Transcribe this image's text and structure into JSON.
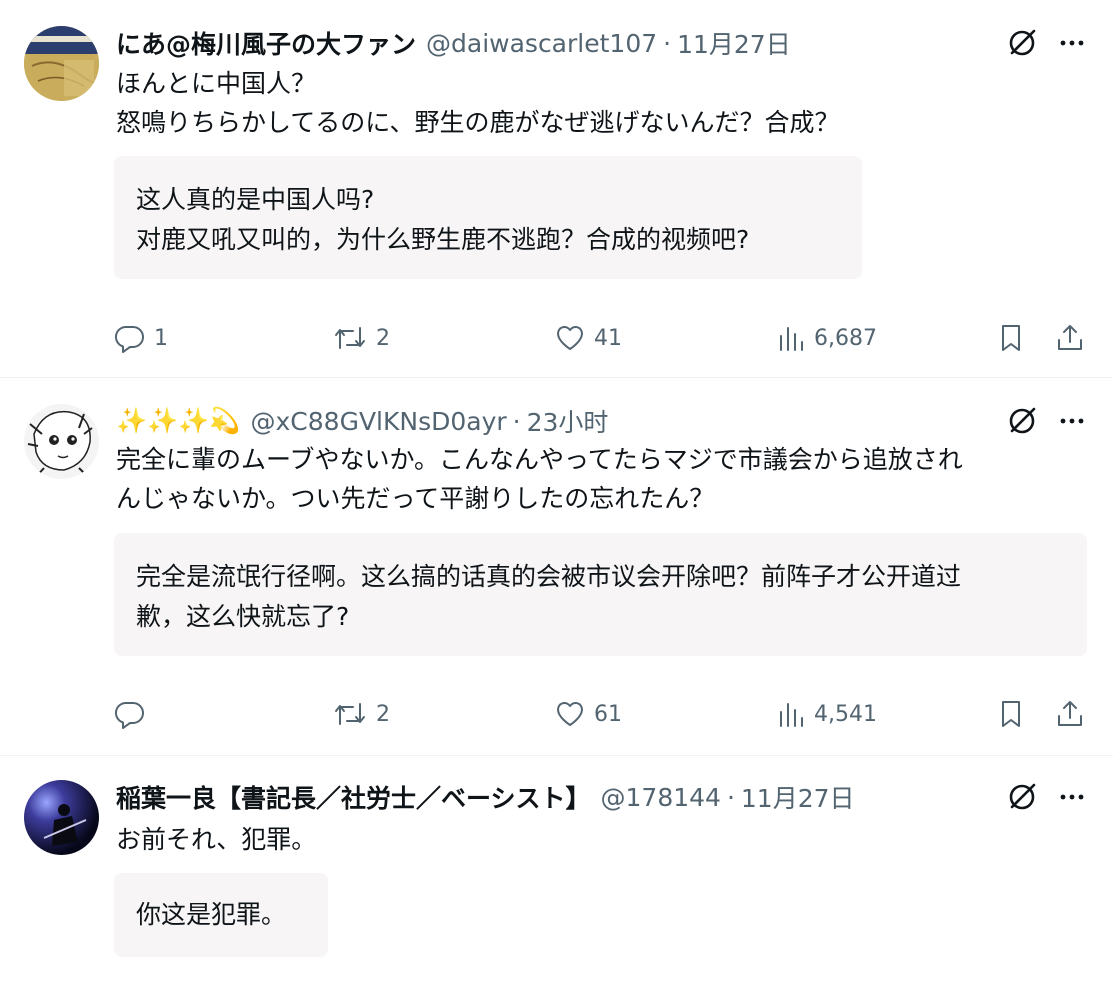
{
  "tweets": [
    {
      "display_name": "にあ@梅川風子の大ファン",
      "handle": "@daiwascarlet107",
      "separator": "·",
      "time": "11月27日",
      "text_lines": [
        "ほんとに中国人？",
        "怒鳴りちらかしてるのに、野生の鹿がなぜ逃げないんだ？合成？"
      ],
      "translation_lines": [
        "这人真的是中国人吗?",
        "对鹿又吼又叫的，为什么野生鹿不逃跑？合成的视频吧?"
      ],
      "actions": {
        "replies": "1",
        "retweets": "2",
        "likes": "41",
        "views": "6,687"
      },
      "avatar_icon": "keirin-ticket-avatar"
    },
    {
      "display_name": "✨✨✨💫",
      "handle": "@xC88GVlKNsD0ayr",
      "separator": "·",
      "time": "23小时",
      "text_lines": [
        "完全に輩のムーブやないか。こんなんやってたらマジで市議会から追放され",
        "んじゃないか。つい先だって平謝りしたの忘れたん？"
      ],
      "translation_lines": [
        "完全是流氓行径啊。这么搞的话真的会被市议会开除吧？前阵子才公开道过",
        "歉，这么快就忘了?"
      ],
      "actions": {
        "replies": "",
        "retweets": "2",
        "likes": "61",
        "views": "4,541"
      },
      "avatar_icon": "anime-sketch-avatar"
    },
    {
      "display_name": "稲葉一良【書記長／社労士／ベーシスト】",
      "handle": "@178144",
      "separator": "·",
      "time": "11月27日",
      "text_lines": [
        "お前それ、犯罪。"
      ],
      "translation_lines": [
        "你这是犯罪。"
      ],
      "avatar_icon": "bassist-stage-avatar"
    }
  ],
  "icons": [
    "grok-icon",
    "more-icon",
    "reply-icon",
    "retweet-icon",
    "like-icon",
    "views-icon",
    "bookmark-icon",
    "share-icon"
  ],
  "colors": {
    "text": "#0f1419",
    "secondary": "#536471",
    "translation_bg": "#f7f5f5",
    "divider": "#eff3f4"
  }
}
